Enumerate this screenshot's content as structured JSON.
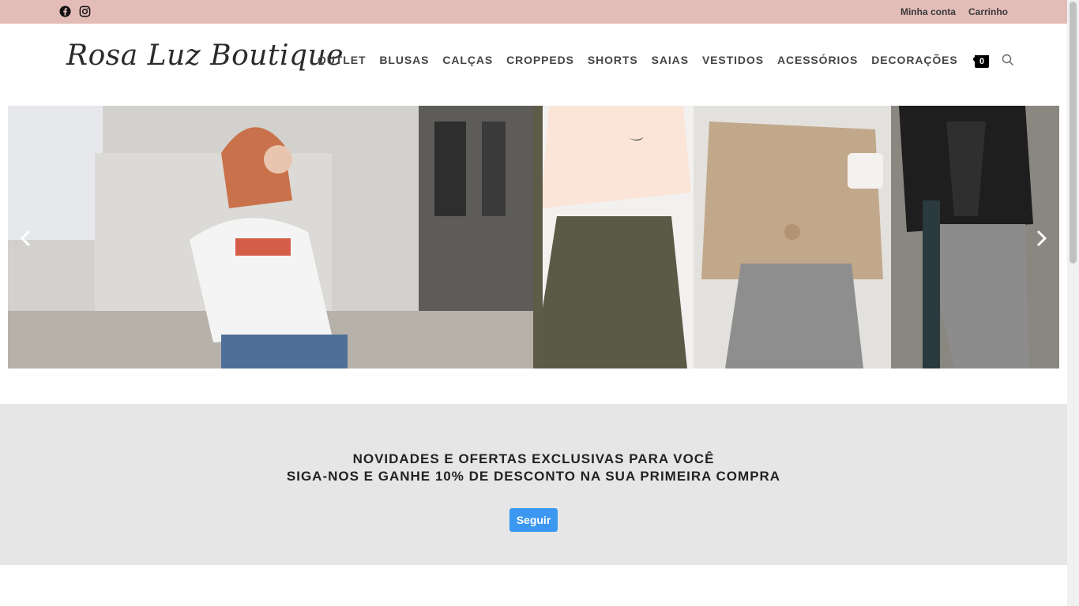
{
  "topbar": {
    "social": [
      {
        "icon": "facebook-icon"
      },
      {
        "icon": "instagram-icon"
      }
    ],
    "links": [
      {
        "label": "Minha conta"
      },
      {
        "label": "Carrinho"
      }
    ]
  },
  "header": {
    "logo": "Rosa Luz Boutique",
    "nav": [
      {
        "label": "OUTLET"
      },
      {
        "label": "BLUSAS"
      },
      {
        "label": "CALÇAS"
      },
      {
        "label": "CROPPEDS"
      },
      {
        "label": "SHORTS"
      },
      {
        "label": "SAIAS"
      },
      {
        "label": "VESTIDOS"
      },
      {
        "label": "ACESSÓRIOS"
      },
      {
        "label": "DECORAÇÕES"
      }
    ],
    "cart_count": "0",
    "cart_icon": "shopping-bag-icon",
    "search_icon": "search-icon"
  },
  "slider": {
    "prev_icon": "chevron-left-icon",
    "next_icon": "chevron-right-icon"
  },
  "promo": {
    "line1": "NOVIDADES E OFERTAS EXCLUSIVAS PARA VOCÊ",
    "line2": "SIGA-NOS E GANHE 10% DE DESCONTO NA SUA PRIMEIRA COMPRA",
    "button": "Seguir",
    "button_color": "#3b97ef",
    "background": "#e6e6e6"
  },
  "colors": {
    "topbar": "#e3bcb8",
    "text": "#444444"
  }
}
